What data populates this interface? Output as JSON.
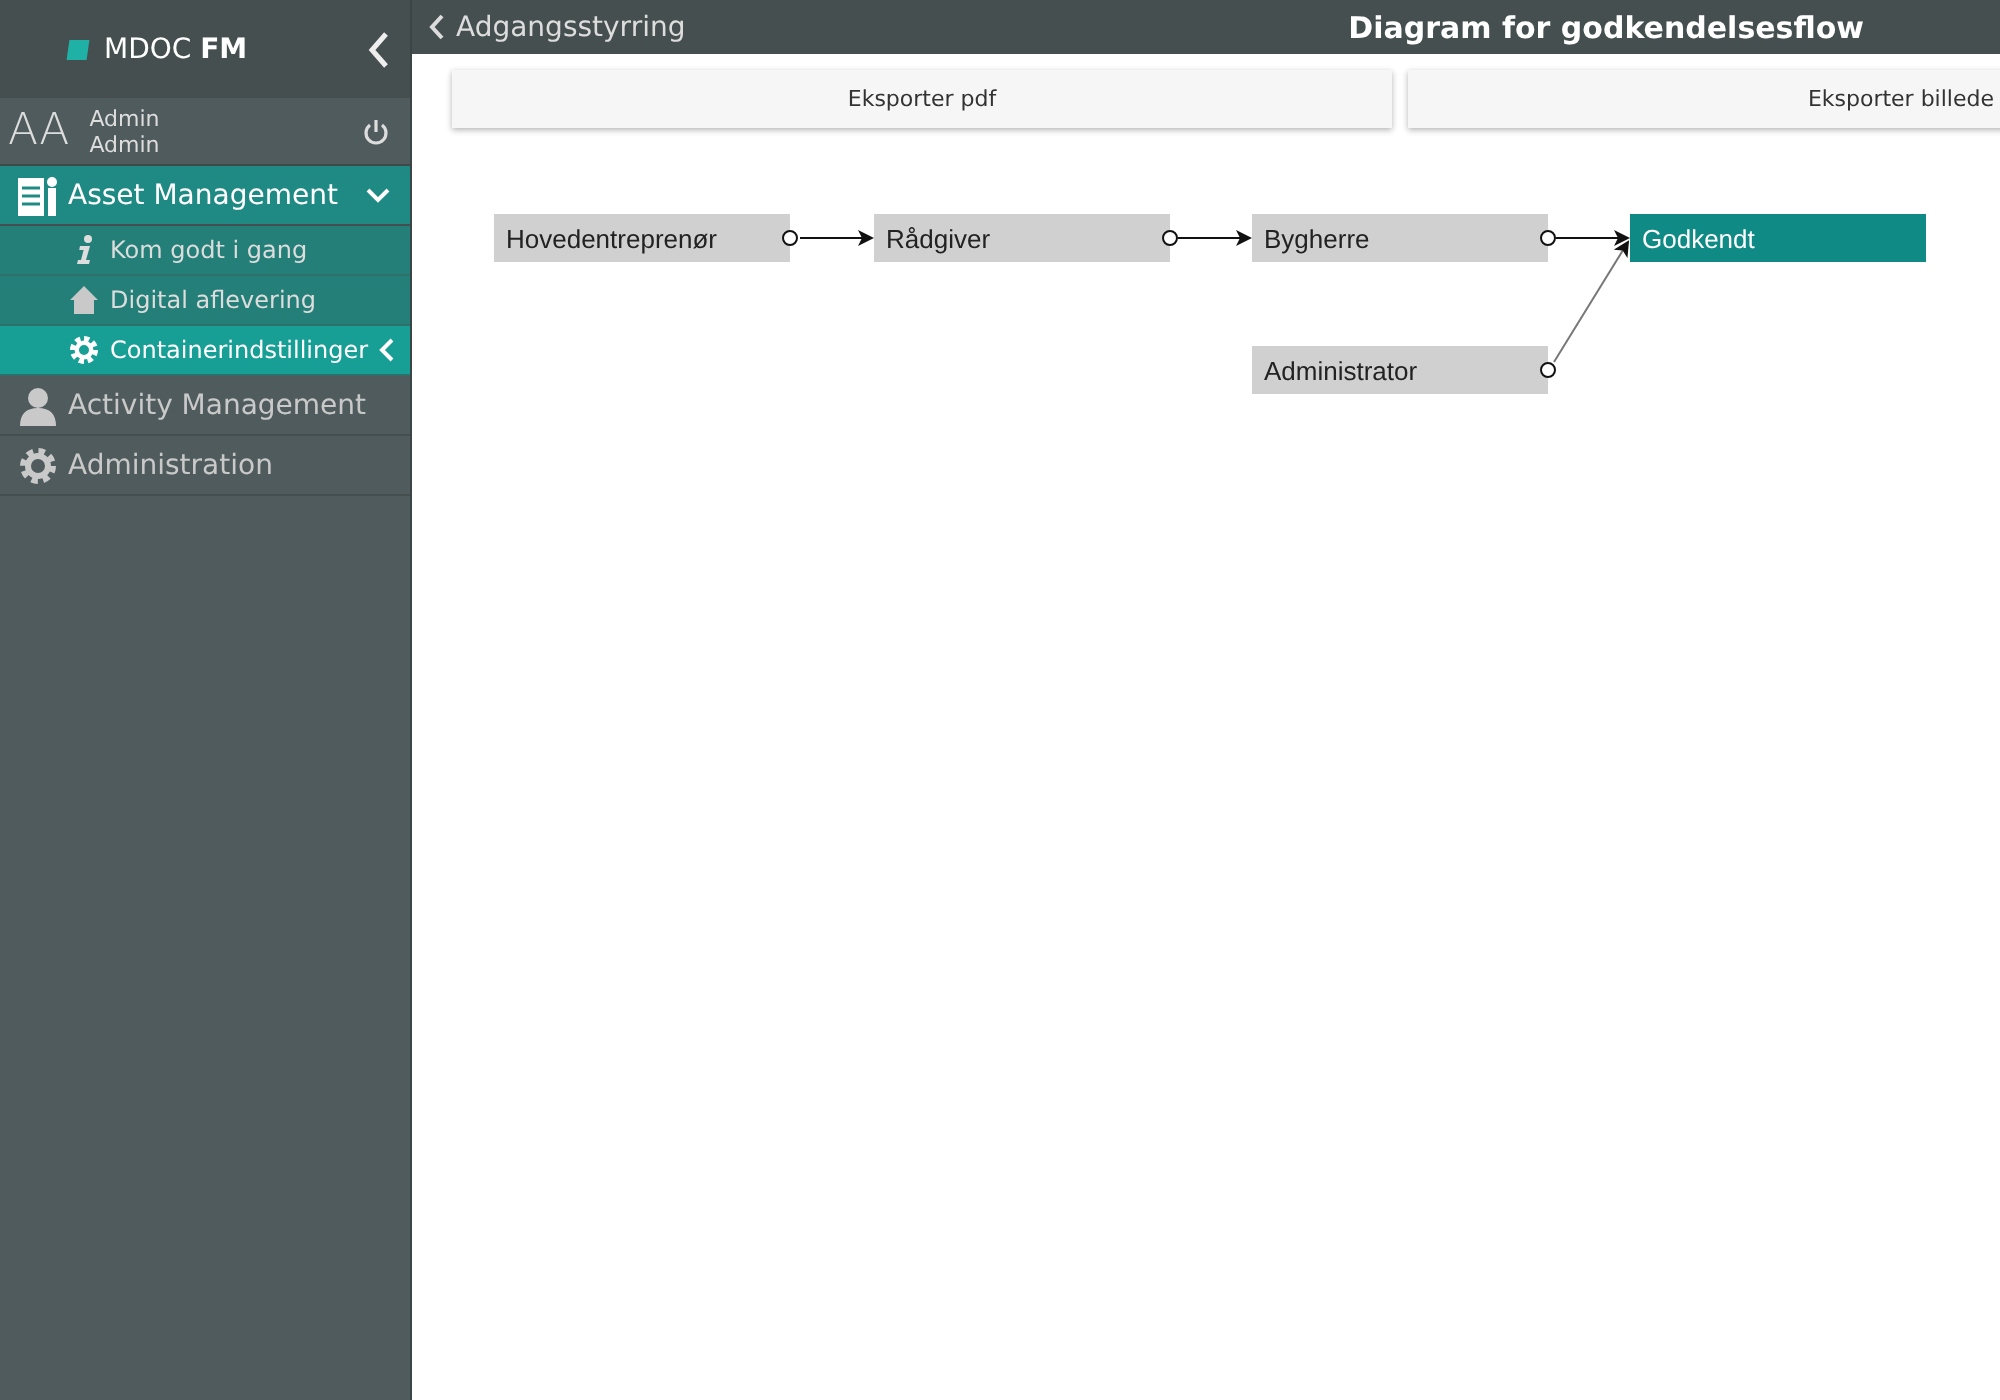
{
  "app": {
    "logo_text": "MDOC",
    "logo_bold": "FM"
  },
  "user": {
    "initials": "AA",
    "first_name": "Admin",
    "last_name": "Admin"
  },
  "sidebar": {
    "items": [
      {
        "label": "Asset Management",
        "expanded": true,
        "children": [
          {
            "label": "Kom godt i gang",
            "selected": false
          },
          {
            "label": "Digital aflevering",
            "selected": false
          },
          {
            "label": "Containerindstillinger",
            "selected": true
          }
        ]
      },
      {
        "label": "Activity Management",
        "expanded": false
      },
      {
        "label": "Administration",
        "expanded": false
      }
    ]
  },
  "header": {
    "back_label": "Adgangsstyrring",
    "title": "Diagram for godkendelsesflow"
  },
  "buttons": [
    "Eksporter pdf",
    "Eksporter billede"
  ],
  "diagram": {
    "nodes": [
      {
        "label": "Hovedentreprenør",
        "kind": "step"
      },
      {
        "label": "Rådgiver",
        "kind": "step"
      },
      {
        "label": "Bygherre",
        "kind": "step"
      },
      {
        "label": "Godkendt",
        "kind": "final"
      },
      {
        "label": "Administrator",
        "kind": "step"
      }
    ]
  }
}
